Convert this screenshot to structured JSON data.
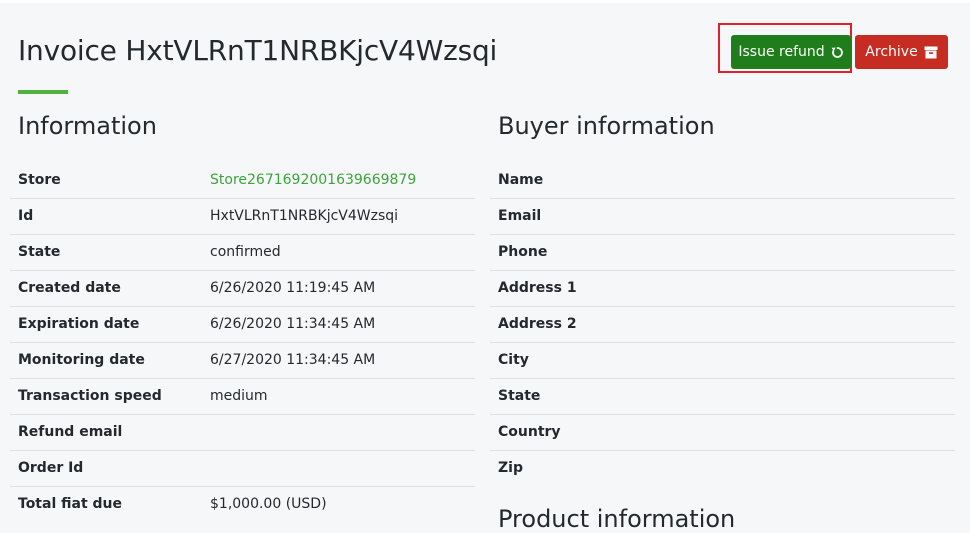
{
  "page": {
    "title": "Invoice HxtVLRnT1NRBKjcV4Wzsqi"
  },
  "actions": {
    "refund_label": "Issue refund",
    "refund_icon": "refresh-icon",
    "archive_label": "Archive",
    "archive_icon": "archive-box-icon",
    "colors": {
      "refund": "#1f7e1b",
      "archive": "#c62c22",
      "highlight": "#e0202a",
      "accent": "#51b13e"
    }
  },
  "information": {
    "title": "Information",
    "rows": [
      {
        "label": "Store",
        "value": "Store2671692001639669879"
      },
      {
        "label": "Id",
        "value": "HxtVLRnT1NRBKjcV4Wzsqi"
      },
      {
        "label": "State",
        "value": "confirmed"
      },
      {
        "label": "Created date",
        "value": "6/26/2020 11:19:45 AM"
      },
      {
        "label": "Expiration date",
        "value": "6/26/2020 11:34:45 AM"
      },
      {
        "label": "Monitoring date",
        "value": "6/27/2020 11:34:45 AM"
      },
      {
        "label": "Transaction speed",
        "value": "medium"
      },
      {
        "label": "Refund email",
        "value": ""
      },
      {
        "label": "Order Id",
        "value": ""
      },
      {
        "label": "Total fiat due",
        "value": "$1,000.00 (USD)"
      }
    ]
  },
  "buyer": {
    "title": "Buyer information",
    "rows": [
      {
        "label": "Name",
        "value": ""
      },
      {
        "label": "Email",
        "value": ""
      },
      {
        "label": "Phone",
        "value": ""
      },
      {
        "label": "Address 1",
        "value": ""
      },
      {
        "label": "Address 2",
        "value": ""
      },
      {
        "label": "City",
        "value": ""
      },
      {
        "label": "State",
        "value": ""
      },
      {
        "label": "Country",
        "value": ""
      },
      {
        "label": "Zip",
        "value": ""
      }
    ]
  },
  "product": {
    "title": "Product information"
  }
}
